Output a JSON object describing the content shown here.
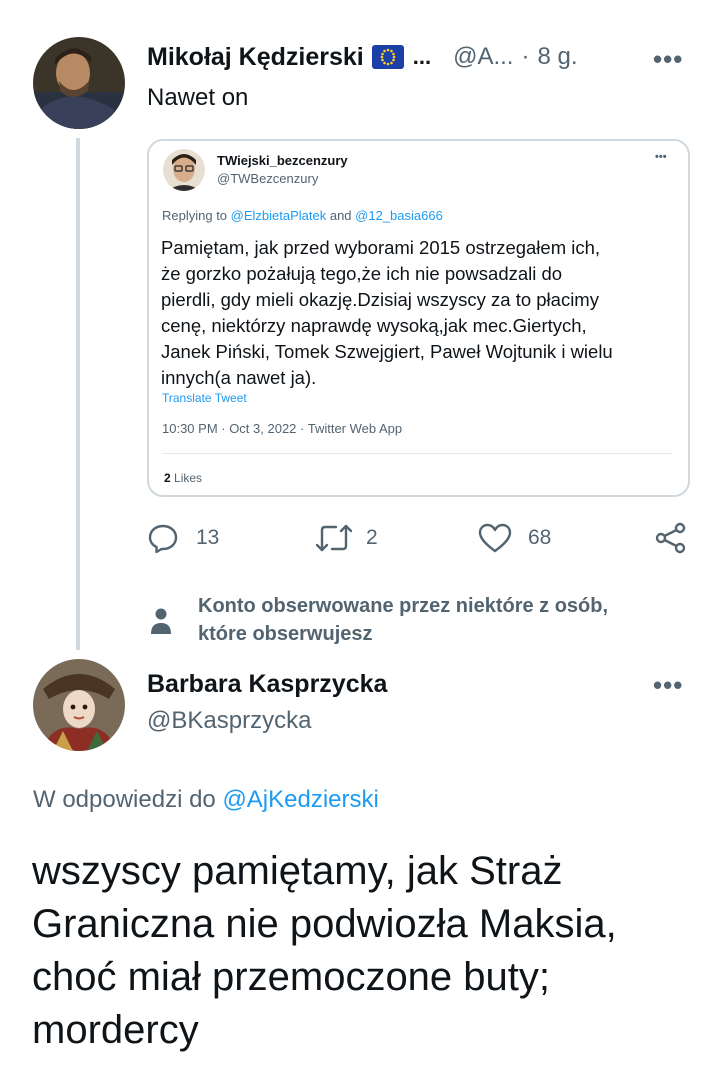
{
  "tweet": {
    "author_name": "Mikołaj Kędzierski",
    "flag_icon": "eu-flag-icon",
    "name_ellipsis": "...",
    "handle": "@A...",
    "separator": "·",
    "time": "8 g.",
    "more": "•••",
    "text": "Nawet on",
    "actions": {
      "reply_count": "13",
      "retweet_count": "2",
      "like_count": "68"
    }
  },
  "embedded": {
    "author_name": "TWiejski_bezcenzury",
    "handle": "@TWBezcenzury",
    "more": "•••",
    "replying_prefix": "Replying to ",
    "replying_user1": "@ElzbietaPlatek",
    "replying_and": " and ",
    "replying_user2": "@12_basia666",
    "body_lines": [
      "Pamiętam, jak przed wyborami 2015 ostrzegałem ich,",
      "że gorzko pożałują tego,że ich nie powsadzali do",
      "pierdli, gdy mieli okazję.Dzisiaj wszyscy za to płacimy",
      "cenę, niektórzy naprawdę wysoką,jak mec.Giertych,",
      "Janek Piński, Tomek Szwejgiert, Paweł Wojtunik i wielu",
      "innych(a nawet ja)."
    ],
    "translate": "Translate Tweet",
    "meta": "10:30 PM · Oct 3, 2022 · Twitter Web App",
    "likes_count": "2",
    "likes_label": "Likes"
  },
  "followed_notice": {
    "line1": "Konto obserwowane przez niektóre z osób,",
    "line2": "które obserwujesz"
  },
  "reply": {
    "author_name": "Barbara Kasprzycka",
    "handle": "@BKasprzycka",
    "more": "•••",
    "reply_to_prefix": "W odpowiedzi do ",
    "reply_to_user": "@AjKedzierski",
    "text_lines": [
      "wszyscy pamiętamy, jak Straż",
      "Graniczna nie podwiozła Maksia,",
      "choć miał przemoczone buty;",
      "mordercy"
    ]
  },
  "colors": {
    "accent": "#1d9bf0",
    "muted": "#536471",
    "text": "#0f1419",
    "border": "#cfd9de"
  }
}
